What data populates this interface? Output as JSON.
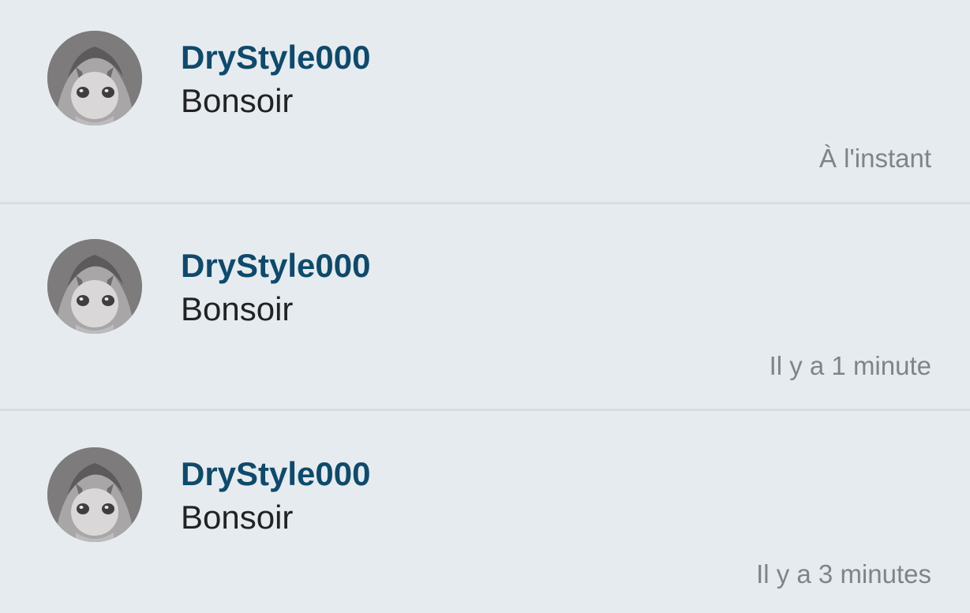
{
  "notifications": [
    {
      "username": "DryStyle000",
      "message": "Bonsoir",
      "time": "À l'instant"
    },
    {
      "username": "DryStyle000",
      "message": "Bonsoir",
      "time": "Il y a 1 minute"
    },
    {
      "username": "DryStyle000",
      "message": "Bonsoir",
      "time": "Il y a 3 minutes"
    }
  ],
  "colors": {
    "background": "#e6ebef",
    "username": "#0e4a6b",
    "message": "#222222",
    "time": "#808487",
    "divider": "#d8dde1"
  }
}
